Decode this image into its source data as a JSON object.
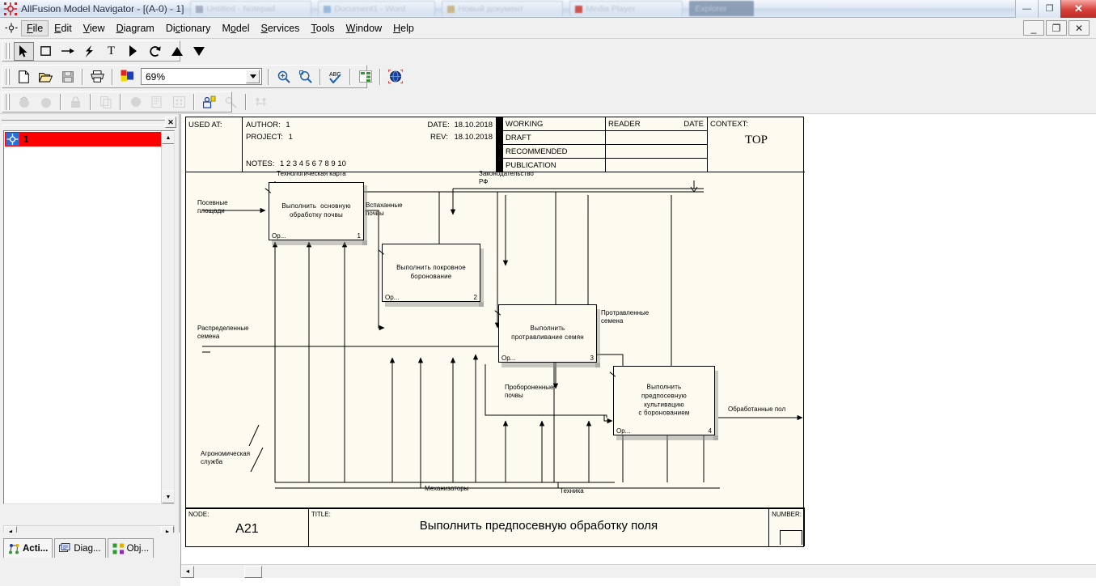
{
  "window": {
    "title": "AllFusion Model Navigator - [(A-0)  - 1]",
    "app_icon": "model-navigator-icon",
    "ghost_tabs": [
      {
        "label": "Untitled - Notepad"
      },
      {
        "label": "Document1 - Word"
      },
      {
        "label": "Новый документ"
      },
      {
        "label": "Media Player"
      },
      {
        "label": "Explorer"
      }
    ],
    "controls": {
      "minimize": "—",
      "maximize": "❐",
      "close": "✕"
    }
  },
  "menubar": {
    "icon": "mdi-restore-icon",
    "items": [
      {
        "label": "File",
        "accel": "F",
        "active": true
      },
      {
        "label": "Edit",
        "accel": "E",
        "active": false
      },
      {
        "label": "View",
        "accel": "V",
        "active": false
      },
      {
        "label": "Diagram",
        "accel": "D",
        "active": false
      },
      {
        "label": "Dictionary",
        "accel": "c",
        "active": false
      },
      {
        "label": "Model",
        "accel": "o",
        "active": false
      },
      {
        "label": "Services",
        "accel": "S",
        "active": false
      },
      {
        "label": "Tools",
        "accel": "T",
        "active": false
      },
      {
        "label": "Window",
        "accel": "W",
        "active": false
      },
      {
        "label": "Help",
        "accel": "H",
        "active": false
      }
    ],
    "mdi_controls": {
      "minimize": "_",
      "restore": "❐",
      "close": "✕"
    }
  },
  "toolbars": {
    "drawing": [
      {
        "name": "pointer-tool",
        "glyph": "➤",
        "selected": true
      },
      {
        "name": "activity-box-tool",
        "glyph": "□",
        "selected": false
      },
      {
        "name": "arrow-tool",
        "glyph": "→",
        "selected": false
      },
      {
        "name": "squiggle-tool",
        "glyph": "⚡",
        "selected": false
      },
      {
        "name": "text-tool",
        "glyph": "T",
        "selected": false
      },
      {
        "name": "tunnel-tool",
        "glyph": "▶",
        "selected": false
      },
      {
        "name": "rotate-tool",
        "glyph": "↺",
        "selected": false
      },
      {
        "name": "up-triangle-tool",
        "glyph": "▲",
        "selected": false
      },
      {
        "name": "down-triangle-tool",
        "glyph": "▼",
        "selected": false
      }
    ],
    "standard": [
      {
        "name": "new-file-button",
        "glyph": "□"
      },
      {
        "name": "open-file-button",
        "glyph": "📂"
      },
      {
        "name": "save-file-button",
        "glyph": "💾"
      },
      {
        "name": "print-button",
        "glyph": "🖨"
      },
      {
        "name": "color-palette-button",
        "glyph": "▣"
      },
      {
        "name": "zoom-in-button",
        "glyph": "🔍"
      },
      {
        "name": "zoom-fit-button",
        "glyph": "⌘"
      },
      {
        "name": "spell-check-button",
        "glyph": "✓"
      },
      {
        "name": "model-explorer-button",
        "glyph": "▤"
      },
      {
        "name": "globe-button",
        "glyph": "🌐"
      }
    ],
    "zoom": {
      "value": "69%",
      "placeholder": "Zoom",
      "dropdown_icon": "chevron-down-icon"
    },
    "disabled_row": [
      {
        "name": "prev-activity-button",
        "glyph": "◉"
      },
      {
        "name": "next-activity-button",
        "glyph": "●"
      },
      {
        "name": "lock-button",
        "glyph": "🔒"
      },
      {
        "name": "copy-model-button",
        "glyph": "⧉"
      },
      {
        "name": "decompose-button",
        "glyph": "⬤"
      },
      {
        "name": "page-button",
        "glyph": "▧"
      },
      {
        "name": "grid-button",
        "glyph": "∷"
      },
      {
        "name": "user-object-button",
        "glyph": "♟"
      },
      {
        "name": "link-object-button",
        "glyph": "⚒"
      },
      {
        "name": "swim-lane-button",
        "glyph": "☸"
      }
    ]
  },
  "left_panel": {
    "close_icon": "close-icon",
    "tree": [
      {
        "label": "1",
        "icon": "model-node-icon",
        "selected": true
      }
    ],
    "scroll_up": "▲",
    "scroll_down": "▼",
    "scroll_left": "◄",
    "scroll_right": "►",
    "tabs": [
      {
        "label": "Acti...",
        "icon": "activity-tree-icon",
        "active": true
      },
      {
        "label": "Diag...",
        "icon": "diagram-tree-icon",
        "active": false
      },
      {
        "label": "Obj...",
        "icon": "object-tree-icon",
        "active": false
      }
    ]
  },
  "diagram": {
    "header": {
      "used_at_label": "USED AT:",
      "author_label": "AUTHOR:",
      "author_value": "1",
      "project_label": "PROJECT:",
      "project_value": "1",
      "date_label": "DATE:",
      "date_value": "18.10.2018",
      "rev_label": "REV:",
      "rev_value": "18.10.2018",
      "notes_label": "NOTES:",
      "notes_value": "1  2  3  4  5  6  7  8  9  10",
      "status": [
        "WORKING",
        "DRAFT",
        "RECOMMENDED",
        "PUBLICATION"
      ],
      "reader_label": "READER",
      "date_col_label": "DATE",
      "context_label": "CONTEXT:",
      "context_value": "TOP"
    },
    "footer": {
      "node_label": "NODE:",
      "node_value": "A21",
      "title_label": "TITLE:",
      "title_value": "Выполнить предпосевную обработку поля",
      "number_label": "NUMBER:"
    },
    "activities": [
      {
        "id": 1,
        "text": "Выполнить  основную\nобработку почвы",
        "number": "1",
        "op": "Ор..."
      },
      {
        "id": 2,
        "text": "Выполнить покровное\nборонование",
        "number": "2",
        "op": "Ор..."
      },
      {
        "id": 3,
        "text": "Выполнить\nпротравливание семян",
        "number": "3",
        "op": "Ор..."
      },
      {
        "id": 4,
        "text": "Выполнить\nпредпосевную\nкультивацию\nс боронованием",
        "number": "4",
        "op": "Ор..."
      }
    ],
    "arrow_labels": [
      {
        "name": "input-sown-areas",
        "text": "Посевные\nплощади"
      },
      {
        "name": "control-tech-map",
        "text": "Технологическая карта"
      },
      {
        "name": "control-legislation",
        "text": "Законодательство\nРФ"
      },
      {
        "name": "flow-plowed-soil",
        "text": "Вспаханные\nпочвы"
      },
      {
        "name": "input-distributed-seeds",
        "text": "Распределенные\nсемена"
      },
      {
        "name": "flow-treated-seeds",
        "text": "Протравленные\nсемена"
      },
      {
        "name": "flow-harrowed-soil",
        "text": "Пробороненные\nпочвы"
      },
      {
        "name": "output-processed-fields",
        "text": "Обработанные пол"
      },
      {
        "name": "mechanism-agro-service",
        "text": "Агрономическая\nслужба"
      },
      {
        "name": "mechanism-machine-operators",
        "text": "Механизаторы"
      },
      {
        "name": "mechanism-equipment",
        "text": "Техника"
      }
    ]
  }
}
